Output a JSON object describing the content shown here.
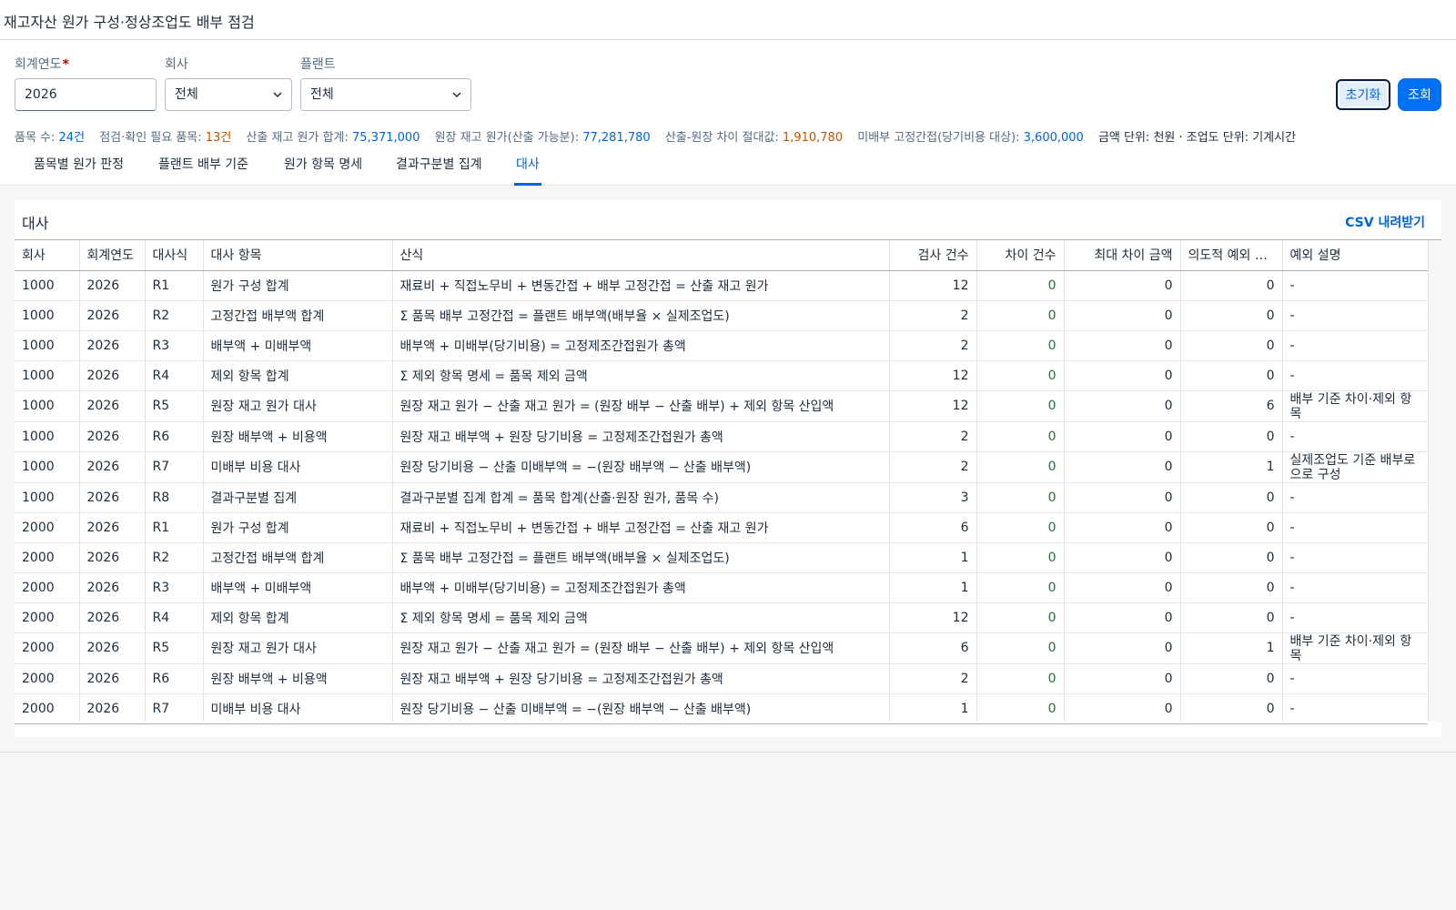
{
  "app": {
    "title": "재고자산 원가 구성·정상조업도 배부 점검"
  },
  "filters": {
    "year": {
      "label": "회계연도",
      "required_mark": "*",
      "value": "2026"
    },
    "company": {
      "label": "회사",
      "value": "전체"
    },
    "plant": {
      "label": "플랜트",
      "value": "전체"
    },
    "reset_label": "초기화",
    "search_label": "조회"
  },
  "kpis": {
    "items_label": "품목 수: ",
    "items_value": "24건",
    "check_label": "점검·확인 필요 품목: ",
    "check_value": "13건",
    "calc_cost_label": "산출 재고 원가 합계: ",
    "calc_cost_value": "75,371,000",
    "ledger_cost_label": "원장 재고 원가(산출 가능분): ",
    "ledger_cost_value": "77,281,780",
    "diff_label": "산출-원장 차이 절대값: ",
    "diff_value": "1,910,780",
    "unalloc_label": "미배부 고정간접(당기비용 대상): ",
    "unalloc_value": "3,600,000",
    "units": "금액 단위: 천원 · 조업도 단위: 기계시간"
  },
  "tabs": [
    {
      "label": "품목별 원가 판정",
      "active": false
    },
    {
      "label": "플랜트 배부 기준",
      "active": false
    },
    {
      "label": "원가 항목 명세",
      "active": false
    },
    {
      "label": "결과구분별 집계",
      "active": false
    },
    {
      "label": "대사",
      "active": true
    }
  ],
  "section": {
    "title": "대사",
    "csv_label": "CSV 내려받기"
  },
  "table": {
    "columns": [
      "회사",
      "회계연도",
      "대사식",
      "대사 항목",
      "산식",
      "검사 건수",
      "차이 건수",
      "최대 차이 금액",
      "의도적 예외 건수",
      "예외 설명"
    ],
    "rows": [
      [
        "1000",
        "2026",
        "R1",
        "원가 구성 합계",
        "재료비 + 직접노무비 + 변동간접 + 배부 고정간접 = 산출 재고 원가",
        "12",
        "0",
        "0",
        "0",
        "-"
      ],
      [
        "1000",
        "2026",
        "R2",
        "고정간접 배부액 합계",
        "Σ 품목 배부 고정간접 = 플랜트 배부액(배부율 × 실제조업도)",
        "2",
        "0",
        "0",
        "0",
        "-"
      ],
      [
        "1000",
        "2026",
        "R3",
        "배부액 + 미배부액",
        "배부액 + 미배부(당기비용) = 고정제조간접원가 총액",
        "2",
        "0",
        "0",
        "0",
        "-"
      ],
      [
        "1000",
        "2026",
        "R4",
        "제외 항목 합계",
        "Σ 제외 항목 명세 = 품목 제외 금액",
        "12",
        "0",
        "0",
        "0",
        "-"
      ],
      [
        "1000",
        "2026",
        "R5",
        "원장 재고 원가 대사",
        "원장 재고 원가 − 산출 재고 원가 = (원장 배부 − 산출 배부) + 제외 항목 산입액",
        "12",
        "0",
        "0",
        "6",
        "배부 기준 차이·제외 항목"
      ],
      [
        "1000",
        "2026",
        "R6",
        "원장 배부액 + 비용액",
        "원장 재고 배부액 + 원장 당기비용 = 고정제조간접원가 총액",
        "2",
        "0",
        "0",
        "0",
        "-"
      ],
      [
        "1000",
        "2026",
        "R7",
        "미배부 비용 대사",
        "원장 당기비용 − 산출 미배부액 = −(원장 배부액 − 산출 배부액)",
        "2",
        "0",
        "0",
        "1",
        "실제조업도 기준 배부로 으로 구성"
      ],
      [
        "1000",
        "2026",
        "R8",
        "결과구분별 집계",
        "결과구분별 집계 합계 = 품목 합계(산출·원장 원가, 품목 수)",
        "3",
        "0",
        "0",
        "0",
        "-"
      ],
      [
        "2000",
        "2026",
        "R1",
        "원가 구성 합계",
        "재료비 + 직접노무비 + 변동간접 + 배부 고정간접 = 산출 재고 원가",
        "6",
        "0",
        "0",
        "0",
        "-"
      ],
      [
        "2000",
        "2026",
        "R2",
        "고정간접 배부액 합계",
        "Σ 품목 배부 고정간접 = 플랜트 배부액(배부율 × 실제조업도)",
        "1",
        "0",
        "0",
        "0",
        "-"
      ],
      [
        "2000",
        "2026",
        "R3",
        "배부액 + 미배부액",
        "배부액 + 미배부(당기비용) = 고정제조간접원가 총액",
        "1",
        "0",
        "0",
        "0",
        "-"
      ],
      [
        "2000",
        "2026",
        "R4",
        "제외 항목 합계",
        "Σ 제외 항목 명세 = 품목 제외 금액",
        "12",
        "0",
        "0",
        "0",
        "-"
      ],
      [
        "2000",
        "2026",
        "R5",
        "원장 재고 원가 대사",
        "원장 재고 원가 − 산출 재고 원가 = (원장 배부 − 산출 배부) + 제외 항목 산입액",
        "6",
        "0",
        "0",
        "1",
        "배부 기준 차이·제외 항목"
      ],
      [
        "2000",
        "2026",
        "R6",
        "원장 배부액 + 비용액",
        "원장 재고 배부액 + 원장 당기비용 = 고정제조간접원가 총액",
        "2",
        "0",
        "0",
        "0",
        "-"
      ],
      [
        "2000",
        "2026",
        "R7",
        "미배부 비용 대사",
        "원장 당기비용 − 산출 미배부액 = −(원장 배부액 − 산출 배부액)",
        "1",
        "0",
        "0",
        "0",
        "-"
      ]
    ]
  }
}
